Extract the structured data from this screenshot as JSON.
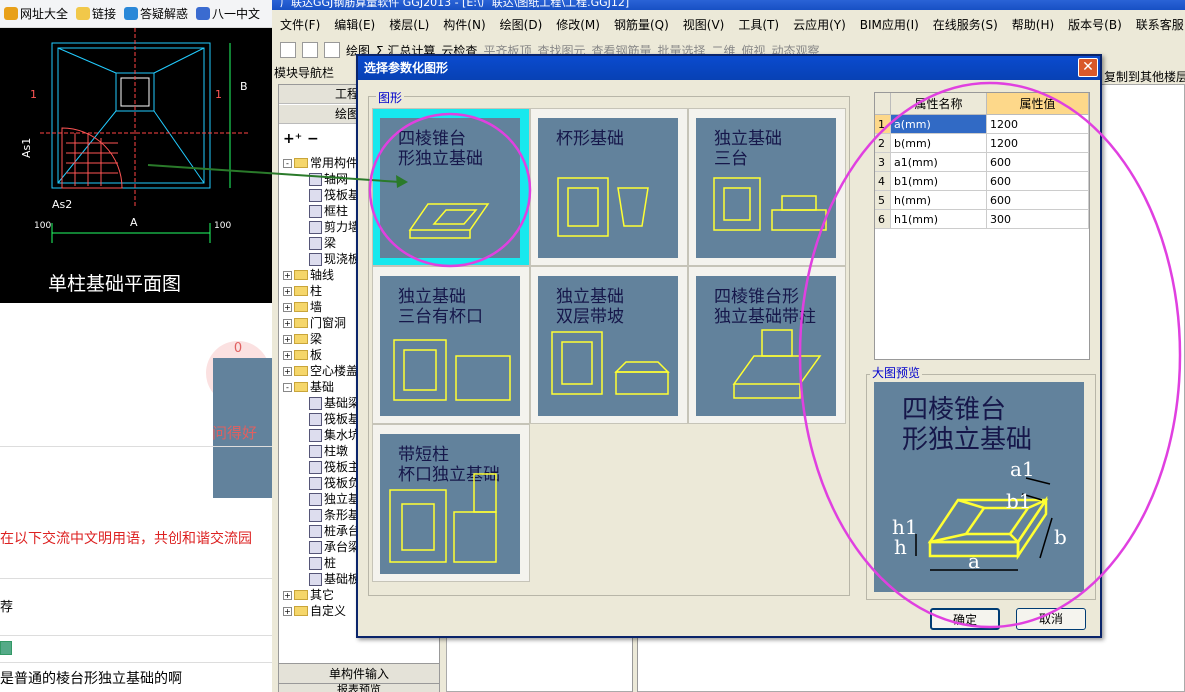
{
  "browser": {
    "bookmarks": [
      {
        "label": "网址大全",
        "icon": "globe-icon",
        "color": "#e8a019"
      },
      {
        "label": "链接",
        "icon": "folder-icon",
        "color": "#f1c84a"
      },
      {
        "label": "答疑解惑",
        "icon": "refresh-icon",
        "color": "#2a88d8"
      },
      {
        "label": "八一中文",
        "icon": "chevron-icon",
        "color": "#3a6bd0"
      }
    ]
  },
  "cad": {
    "title": "单柱基础平面图",
    "labels": {
      "b": "B",
      "one": "1",
      "as1": "As1",
      "as2": "As2",
      "a": "A",
      "d100a": "100",
      "d100b": "100"
    }
  },
  "article": {
    "like_count": "0",
    "ask_good": "问得好",
    "warning": "在以下交流中文明用语，共创和谐交流园",
    "small": "荐",
    "bottom": "是普通的棱台形独立基础的啊"
  },
  "app": {
    "title": "广联达GGJ钢筋算量软件 GGJ2013 - [E:\\广联达\\图纸工程\\工程.GGJ12]",
    "menus": [
      "文件(F)",
      "编辑(E)",
      "楼层(L)",
      "构件(N)",
      "绘图(D)",
      "修改(M)",
      "钢筋量(Q)",
      "视图(V)",
      "工具(T)",
      "云应用(Y)",
      "BIM应用(I)",
      "在线服务(S)",
      "帮助(H)",
      "版本号(B)",
      "联系客服"
    ],
    "toolbar": [
      "绘图",
      "Σ 汇总计算",
      "云检查",
      "平齐板顶",
      "查找图元",
      "查看钢筋量",
      "批量选择",
      "二维",
      "俯视",
      "动态观察"
    ],
    "nav_label": "模块导航栏",
    "right_label": "复制到其他楼层",
    "left_buttons": [
      "工程设置",
      "绘图输入"
    ],
    "tree": [
      {
        "label": "常用构件类型",
        "level": 0,
        "expand": "-"
      },
      {
        "label": "轴网",
        "level": 1
      },
      {
        "label": "筏板基础",
        "level": 1
      },
      {
        "label": "框柱",
        "level": 1
      },
      {
        "label": "剪力墙",
        "level": 1
      },
      {
        "label": "梁",
        "level": 1
      },
      {
        "label": "现浇板",
        "level": 1
      },
      {
        "label": "轴线",
        "level": 0,
        "expand": "+"
      },
      {
        "label": "柱",
        "level": 0,
        "expand": "+"
      },
      {
        "label": "墙",
        "level": 0,
        "expand": "+"
      },
      {
        "label": "门窗洞",
        "level": 0,
        "expand": "+"
      },
      {
        "label": "梁",
        "level": 0,
        "expand": "+"
      },
      {
        "label": "板",
        "level": 0,
        "expand": "+"
      },
      {
        "label": "空心楼盖",
        "level": 0,
        "expand": "+"
      },
      {
        "label": "基础",
        "level": 0,
        "expand": "-"
      },
      {
        "label": "基础梁",
        "level": 1
      },
      {
        "label": "筏板基础",
        "level": 1
      },
      {
        "label": "集水坑",
        "level": 1
      },
      {
        "label": "柱墩",
        "level": 1
      },
      {
        "label": "筏板主筋",
        "level": 1
      },
      {
        "label": "筏板负筋",
        "level": 1
      },
      {
        "label": "独立基础",
        "level": 1
      },
      {
        "label": "条形基础",
        "level": 1
      },
      {
        "label": "桩承台",
        "level": 1
      },
      {
        "label": "承台梁",
        "level": 1
      },
      {
        "label": "桩",
        "level": 1
      },
      {
        "label": "基础板带",
        "level": 1
      },
      {
        "label": "其它",
        "level": 0,
        "expand": "+"
      },
      {
        "label": "自定义",
        "level": 0,
        "expand": "+"
      }
    ],
    "bottom_buttons": [
      "单构件输入",
      "报表预览"
    ]
  },
  "dialog": {
    "title": "选择参数化图形",
    "group_label": "图形",
    "preview_label": "大图预览",
    "ok": "确定",
    "cancel": "取消",
    "shapes": [
      {
        "title": "四棱锥台\n形独立基础",
        "selected": true
      },
      {
        "title": "杯形基础",
        "selected": false
      },
      {
        "title": "独立基础\n三台",
        "selected": false
      },
      {
        "title": "独立基础\n三台有杯口",
        "selected": false
      },
      {
        "title": "独立基础\n双层带坡",
        "selected": false
      },
      {
        "title": "四棱锥台形\n独立基础带柱",
        "selected": false
      },
      {
        "title": "带短柱\n杯口独立基础",
        "selected": false
      }
    ],
    "shape_labels": [
      "a1",
      "b1",
      "h1",
      "h",
      "a",
      "b"
    ],
    "table": {
      "headers": [
        "属性名称",
        "属性值"
      ],
      "rows": [
        {
          "n": "1",
          "name": "a(mm)",
          "value": "1200"
        },
        {
          "n": "2",
          "name": "b(mm)",
          "value": "1200"
        },
        {
          "n": "3",
          "name": "a1(mm)",
          "value": "600"
        },
        {
          "n": "4",
          "name": "b1(mm)",
          "value": "600"
        },
        {
          "n": "5",
          "name": "h(mm)",
          "value": "600"
        },
        {
          "n": "6",
          "name": "h1(mm)",
          "value": "300"
        }
      ]
    },
    "preview_title_line1": "四棱锥台",
    "preview_title_line2": "形独立基础"
  }
}
